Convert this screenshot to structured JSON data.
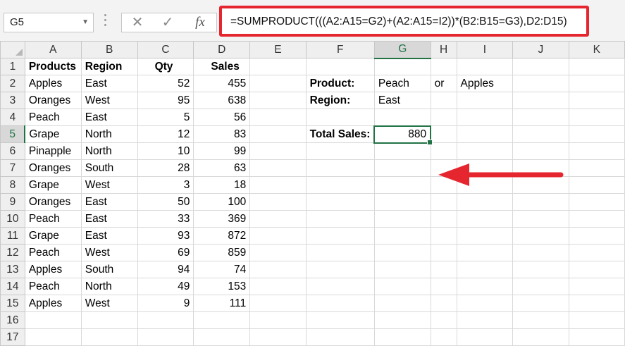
{
  "name_box": "G5",
  "formula_bar": {
    "cancel_glyph": "✕",
    "enter_glyph": "✓",
    "fx_label": "fx",
    "formula": "=SUMPRODUCT(((A2:A15=G2)+(A2:A15=I2))*(B2:B15=G3),D2:D15)"
  },
  "columns": [
    "A",
    "B",
    "C",
    "D",
    "E",
    "F",
    "G",
    "H",
    "I",
    "J",
    "K"
  ],
  "rows": [
    {
      "n": "1",
      "A": "Products",
      "B": "Region",
      "C": "Qty",
      "D": "Sales"
    },
    {
      "n": "2",
      "A": "Apples",
      "B": "East",
      "C": "52",
      "D": "455",
      "F": "Product:",
      "G": "Peach",
      "H": "or",
      "I": "Apples"
    },
    {
      "n": "3",
      "A": "Oranges",
      "B": "West",
      "C": "95",
      "D": "638",
      "F": "Region:",
      "G": "East"
    },
    {
      "n": "4",
      "A": "Peach",
      "B": "East",
      "C": "5",
      "D": "56"
    },
    {
      "n": "5",
      "A": "Grape",
      "B": "North",
      "C": "12",
      "D": "83",
      "F": "Total Sales:",
      "G": "880"
    },
    {
      "n": "6",
      "A": "Pinapple",
      "B": "North",
      "C": "10",
      "D": "99"
    },
    {
      "n": "7",
      "A": "Oranges",
      "B": "South",
      "C": "28",
      "D": "63"
    },
    {
      "n": "8",
      "A": "Grape",
      "B": "West",
      "C": "3",
      "D": "18"
    },
    {
      "n": "9",
      "A": "Oranges",
      "B": "East",
      "C": "50",
      "D": "100"
    },
    {
      "n": "10",
      "A": "Peach",
      "B": "East",
      "C": "33",
      "D": "369"
    },
    {
      "n": "11",
      "A": "Grape",
      "B": "East",
      "C": "93",
      "D": "872"
    },
    {
      "n": "12",
      "A": "Peach",
      "B": "West",
      "C": "69",
      "D": "859"
    },
    {
      "n": "13",
      "A": "Apples",
      "B": "South",
      "C": "94",
      "D": "74"
    },
    {
      "n": "14",
      "A": "Peach",
      "B": "North",
      "C": "49",
      "D": "153"
    },
    {
      "n": "15",
      "A": "Apples",
      "B": "West",
      "C": "9",
      "D": "111"
    },
    {
      "n": "16"
    },
    {
      "n": "17"
    }
  ],
  "active_cell": {
    "col": "G",
    "row": "5"
  },
  "colors": {
    "highlight_red": "#e5262f",
    "excel_green": "#217346"
  }
}
